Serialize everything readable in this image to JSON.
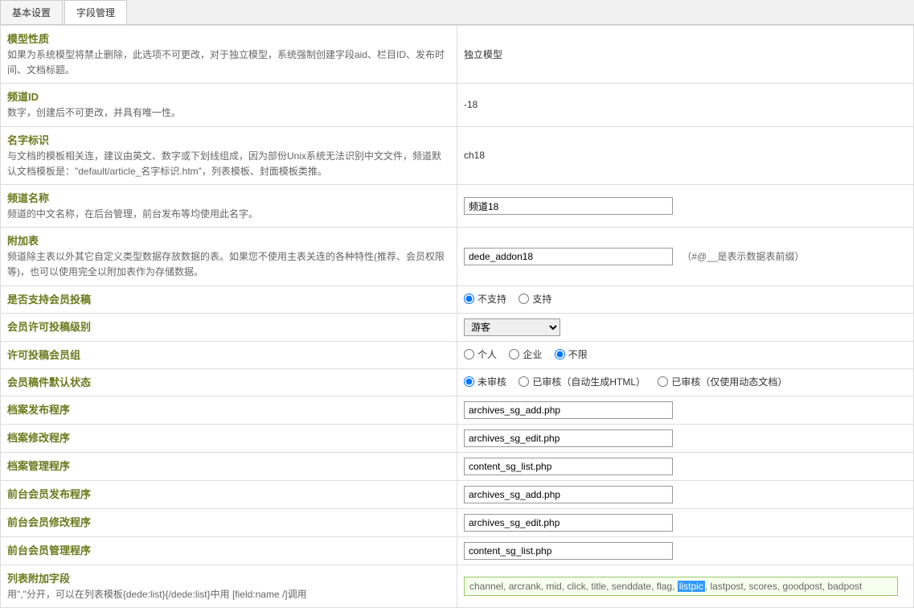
{
  "tabs": {
    "basic": "基本设置",
    "fields": "字段管理"
  },
  "rows": {
    "model_nature": {
      "title": "模型性质",
      "desc": "如果为系统模型将禁止删除，此选项不可更改，对于独立模型，系统强制创建字段aid、栏目ID、发布时间、文档标题。",
      "value": "独立模型"
    },
    "channel_id": {
      "title": "频道ID",
      "desc": "数字，创建后不可更改，并具有唯一性。",
      "value": "-18"
    },
    "name_id": {
      "title": "名字标识",
      "desc": "与文档的模板相关连，建议由英文、数字或下划线组成，因为部份Unix系统无法识别中文文件，频道默认文档模板是：\"default/article_名字标识.htm\"，列表模板、封面模板类推。",
      "value": "ch18"
    },
    "channel_name": {
      "title": "频道名称",
      "desc": "频道的中文名称，在后台管理，前台发布等均使用此名字。",
      "value": "频道18"
    },
    "addon_table": {
      "title": "附加表",
      "desc": "频道除主表以外其它自定义类型数据存放数据的表。如果您不使用主表关连的各种特性(推荐、会员权限等)，也可以使用完全以附加表作为存储数据。",
      "value": "dede_addon18",
      "note": "（#@__是表示数据表前缀）"
    },
    "member_post": {
      "title": "是否支持会员投稿",
      "no": "不支持",
      "yes": "支持"
    },
    "member_level": {
      "title": "会员许可投稿级别",
      "value": "游客"
    },
    "member_group": {
      "title": "许可投稿会员组",
      "personal": "个人",
      "enterprise": "企业",
      "unlimited": "不限"
    },
    "default_status": {
      "title": "会员稿件默认状态",
      "unreviewed": "未审核",
      "reviewed_html": "已审核（自动生成HTML）",
      "reviewed_dynamic": "已审核（仅使用动态文档）"
    },
    "archive_add": {
      "title": "档案发布程序",
      "value": "archives_sg_add.php"
    },
    "archive_edit": {
      "title": "档案修改程序",
      "value": "archives_sg_edit.php"
    },
    "archive_manage": {
      "title": "档案管理程序",
      "value": "content_sg_list.php"
    },
    "front_add": {
      "title": "前台会员发布程序",
      "value": "archives_sg_add.php"
    },
    "front_edit": {
      "title": "前台会员修改程序",
      "value": "archives_sg_edit.php"
    },
    "front_manage": {
      "title": "前台会员管理程序",
      "value": "content_sg_list.php"
    },
    "list_fields": {
      "title": "列表附加字段",
      "desc": "用\",\"分开，可以在列表模板{dede:list}{/dede:list}中用 [field:name /]调用",
      "prefix": "channel, arcrank, mid, click, title, senddate, flag, ",
      "highlighted": "listpic",
      "suffix": ", lastpost, scores, goodpost, badpost"
    }
  }
}
